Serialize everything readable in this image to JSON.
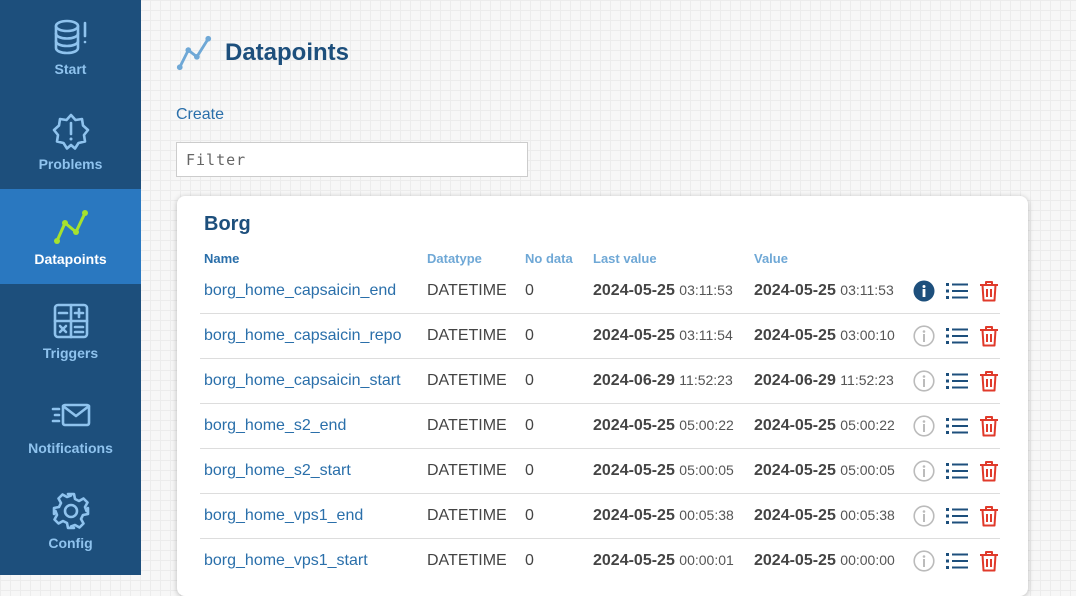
{
  "sidebar": {
    "items": [
      {
        "label": "Start",
        "icon": "database-alert-icon",
        "active": false
      },
      {
        "label": "Problems",
        "icon": "alert-badge-icon",
        "active": false
      },
      {
        "label": "Datapoints",
        "icon": "chart-line-icon",
        "active": true
      },
      {
        "label": "Triggers",
        "icon": "calculator-icon",
        "active": false
      },
      {
        "label": "Notifications",
        "icon": "mail-icon",
        "active": false
      },
      {
        "label": "Config",
        "icon": "gear-icon",
        "active": false
      }
    ]
  },
  "page": {
    "title": "Datapoints",
    "create_label": "Create",
    "filter_placeholder": "Filter"
  },
  "group": {
    "title": "Borg",
    "columns": [
      "Name",
      "Datatype",
      "No data",
      "Last value",
      "Value"
    ],
    "rows": [
      {
        "name": "borg_home_capsaicin_end",
        "datatype": "DATETIME",
        "nodata": "0",
        "last_date": "2024-05-25",
        "last_time": "03:11:53",
        "val_date": "2024-05-25",
        "val_time": "03:11:53",
        "info_active": true
      },
      {
        "name": "borg_home_capsaicin_repo",
        "datatype": "DATETIME",
        "nodata": "0",
        "last_date": "2024-05-25",
        "last_time": "03:11:54",
        "val_date": "2024-05-25",
        "val_time": "03:00:10",
        "info_active": false
      },
      {
        "name": "borg_home_capsaicin_start",
        "datatype": "DATETIME",
        "nodata": "0",
        "last_date": "2024-06-29",
        "last_time": "11:52:23",
        "val_date": "2024-06-29",
        "val_time": "11:52:23",
        "info_active": false
      },
      {
        "name": "borg_home_s2_end",
        "datatype": "DATETIME",
        "nodata": "0",
        "last_date": "2024-05-25",
        "last_time": "05:00:22",
        "val_date": "2024-05-25",
        "val_time": "05:00:22",
        "info_active": false
      },
      {
        "name": "borg_home_s2_start",
        "datatype": "DATETIME",
        "nodata": "0",
        "last_date": "2024-05-25",
        "last_time": "05:00:05",
        "val_date": "2024-05-25",
        "val_time": "05:00:05",
        "info_active": false
      },
      {
        "name": "borg_home_vps1_end",
        "datatype": "DATETIME",
        "nodata": "0",
        "last_date": "2024-05-25",
        "last_time": "00:05:38",
        "val_date": "2024-05-25",
        "val_time": "00:05:38",
        "info_active": false
      },
      {
        "name": "borg_home_vps1_start",
        "datatype": "DATETIME",
        "nodata": "0",
        "last_date": "2024-05-25",
        "last_time": "00:00:01",
        "val_date": "2024-05-25",
        "val_time": "00:00:00",
        "info_active": false
      }
    ]
  },
  "colors": {
    "sidebar_bg": "#1d4f7c",
    "sidebar_active": "#2a78c0",
    "accent_green": "#a6e22e",
    "link": "#2a6faa",
    "delete_red": "#e03a2b"
  }
}
